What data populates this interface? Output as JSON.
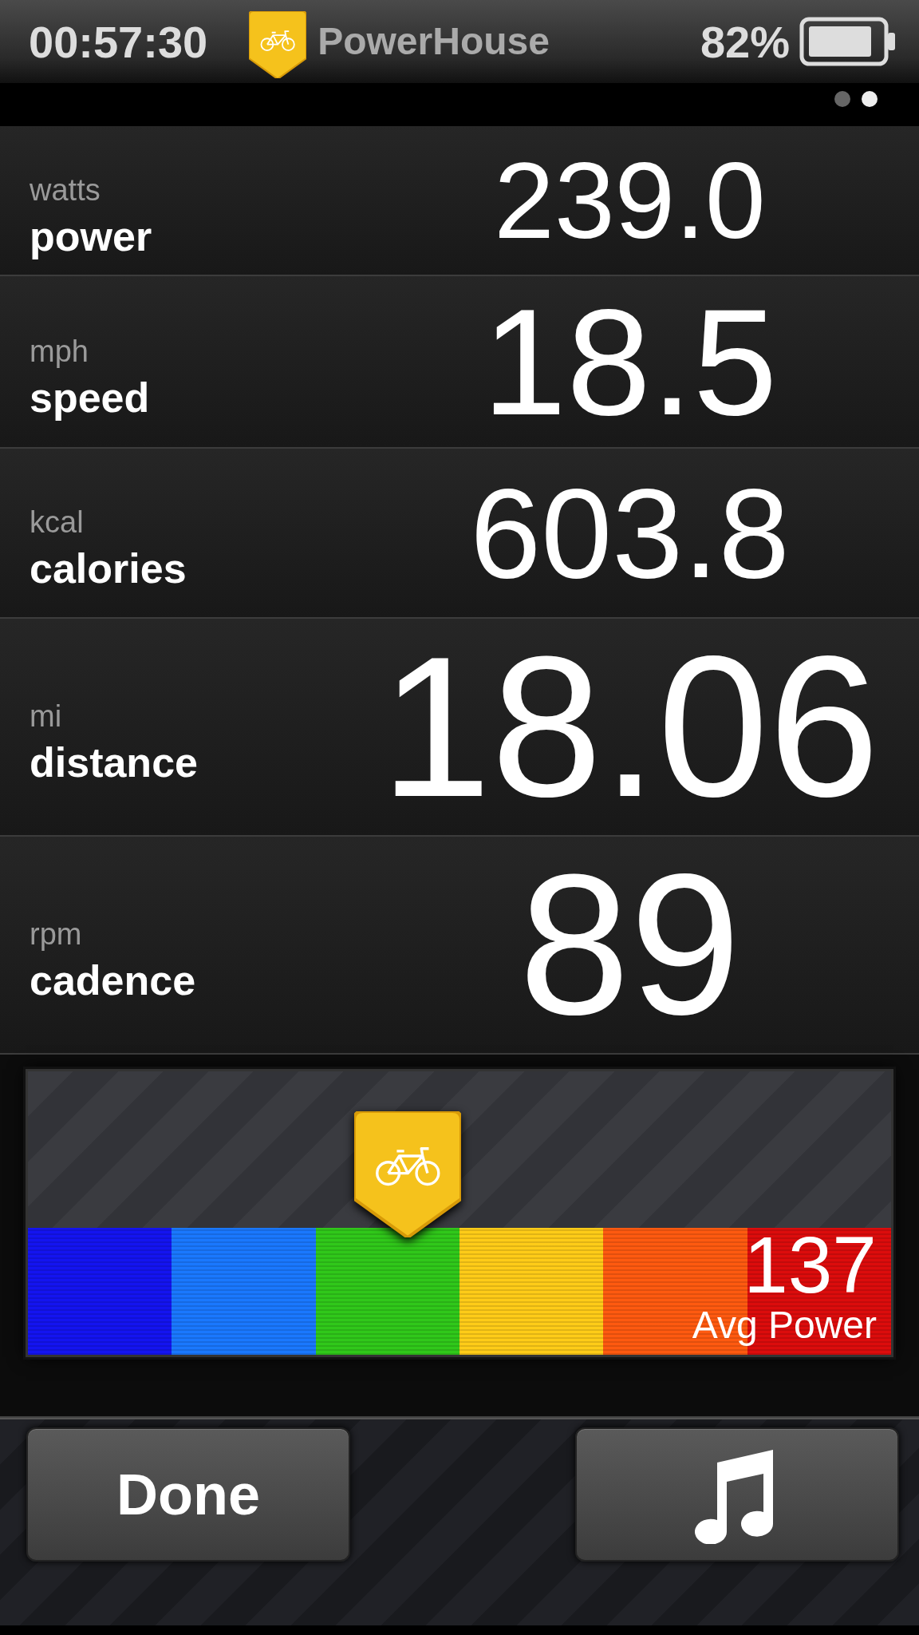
{
  "status_bar": {
    "time": "00:57:30",
    "app_name": "PowerHouse",
    "battery": "82%"
  },
  "page_dots": [
    {
      "selected": false
    },
    {
      "selected": true
    }
  ],
  "metrics": [
    {
      "unit": "watts",
      "name": "power",
      "value": "239.0"
    },
    {
      "unit": "mph",
      "name": "speed",
      "value": "18.5"
    },
    {
      "unit": "kcal",
      "name": "calories",
      "value": "603.8"
    },
    {
      "unit": "mi",
      "name": "distance",
      "value": "18.06"
    },
    {
      "unit": "rpm",
      "name": "cadence",
      "value": "89"
    }
  ],
  "zone_meter": {
    "level": 0.44,
    "value": "137",
    "label": "Avg Power",
    "zones": [
      {
        "color": "#1414f0"
      },
      {
        "color": "#1a78ff"
      },
      {
        "color": "#30c81a"
      },
      {
        "color": "#ffcc18"
      },
      {
        "color": "#ff5a10"
      },
      {
        "color": "#dc0c0c"
      }
    ]
  },
  "buttons": [
    {
      "kind": "text",
      "label": "Done"
    },
    {
      "kind": "music"
    }
  ]
}
